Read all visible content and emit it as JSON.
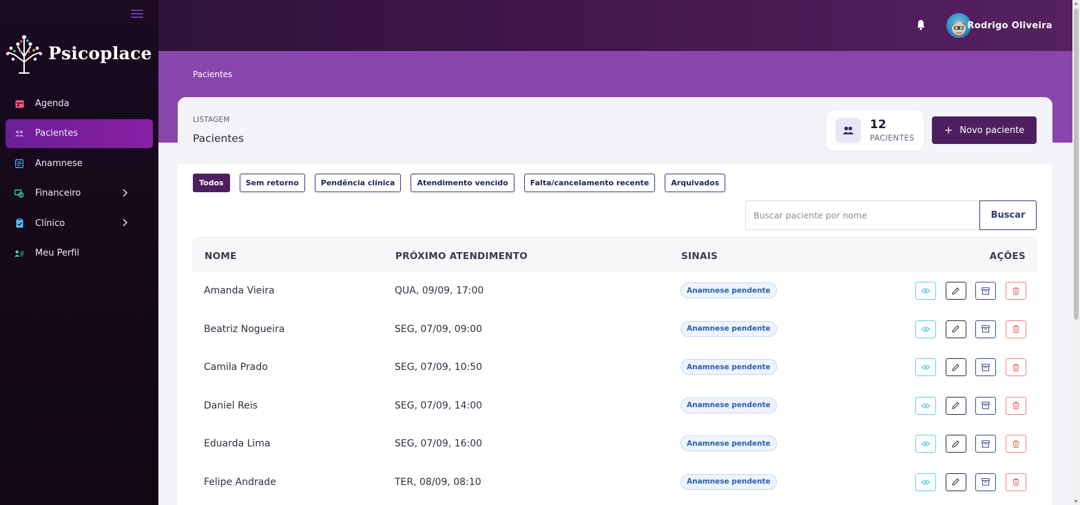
{
  "sidebar": {
    "brand": "Psicoplace",
    "items": [
      {
        "label": "Agenda",
        "icon": "calendar-icon",
        "color": "#f05a7e"
      },
      {
        "label": "Pacientes",
        "icon": "users-icon",
        "color": "#b56cd3",
        "active": true
      },
      {
        "label": "Anamnese",
        "icon": "document-icon",
        "color": "#4fa8e8"
      },
      {
        "label": "Financeiro",
        "icon": "money-icon",
        "color": "#3fd49a",
        "has_submenu": true
      },
      {
        "label": "Clínico",
        "icon": "clipboard-icon",
        "color": "#4fc3f7",
        "has_submenu": true
      },
      {
        "label": "Meu Perfil",
        "icon": "profile-icon",
        "color": "#3fd49a"
      }
    ]
  },
  "header": {
    "user_name": "Rodrigo Oliveira"
  },
  "breadcrumb": "Pacientes",
  "card": {
    "eyebrow": "LISTAGEM",
    "title": "Pacientes",
    "count": "12",
    "count_label": "PACIENTES",
    "new_button": "Novo paciente",
    "new_button_plus": "+"
  },
  "filters": [
    {
      "label": "Todos",
      "active": true
    },
    {
      "label": "Sem retorno"
    },
    {
      "label": "Pendência clínica"
    },
    {
      "label": "Atendimento vencido"
    },
    {
      "label": "Falta/cancelamento recente"
    },
    {
      "label": "Arquivados"
    }
  ],
  "search": {
    "placeholder": "Buscar paciente por nome",
    "button": "Buscar"
  },
  "table": {
    "headers": {
      "name": "NOME",
      "next": "PRÓXIMO ATENDIMENTO",
      "signals": "SINAIS",
      "actions": "AÇÕES"
    },
    "rows": [
      {
        "name": "Amanda Vieira",
        "next": "QUA, 09/09, 17:00",
        "signal": "Anamnese pendente"
      },
      {
        "name": "Beatriz Nogueira",
        "next": "SEG, 07/09, 09:00",
        "signal": "Anamnese pendente"
      },
      {
        "name": "Camila Prado",
        "next": "SEG, 07/09, 10:50",
        "signal": "Anamnese pendente"
      },
      {
        "name": "Daniel Reis",
        "next": "SEG, 07/09, 14:00",
        "signal": "Anamnese pendente"
      },
      {
        "name": "Eduarda Lima",
        "next": "SEG, 07/09, 16:00",
        "signal": "Anamnese pendente"
      },
      {
        "name": "Felipe Andrade",
        "next": "TER, 08/09, 08:10",
        "signal": "Anamnese pendente"
      }
    ]
  },
  "colors": {
    "primary_dark": "#4d1f5e",
    "band_purple": "#8a45ad",
    "active_nav": "#7a1fa0"
  }
}
